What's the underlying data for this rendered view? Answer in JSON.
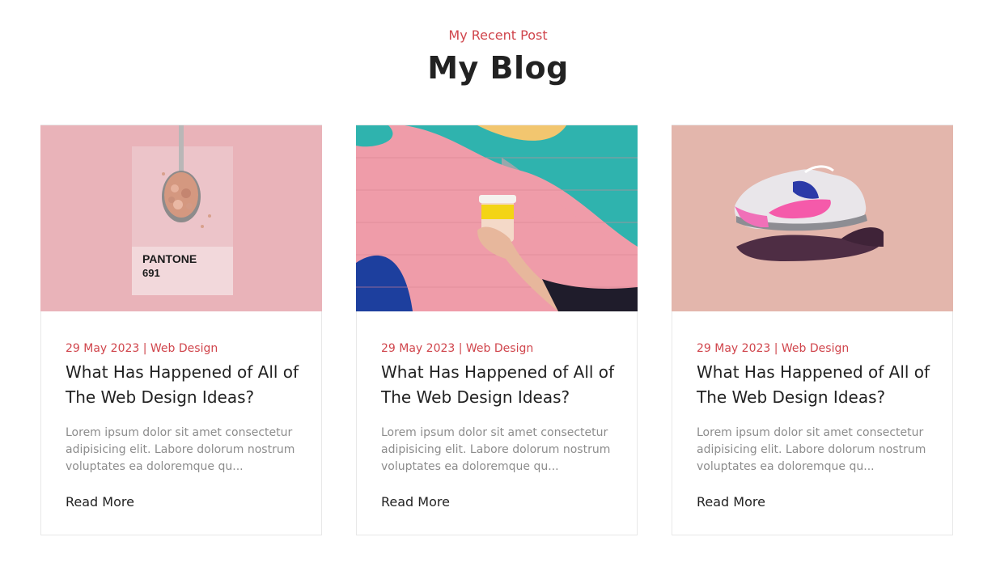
{
  "header": {
    "eyebrow": "My Recent Post",
    "title": "My Blog"
  },
  "posts": [
    {
      "meta": "29 May 2023 | Web Design",
      "title": "What Has Happened of All of The Web Design Ideas?",
      "excerpt": "Lorem ipsum dolor sit amet consectetur adipisicing elit. Labore dolorum nostrum voluptates ea doloremque qu...",
      "link": "Read More",
      "image": {
        "card_text": "PANTONE",
        "card_code": "691"
      }
    },
    {
      "meta": "29 May 2023 | Web Design",
      "title": "What Has Happened of All of The Web Design Ideas?",
      "excerpt": "Lorem ipsum dolor sit amet consectetur adipisicing elit. Labore dolorum nostrum voluptates ea doloremque qu...",
      "link": "Read More"
    },
    {
      "meta": "29 May 2023 | Web Design",
      "title": "What Has Happened of All of The Web Design Ideas?",
      "excerpt": "Lorem ipsum dolor sit amet consectetur adipisicing elit. Labore dolorum nostrum voluptates ea doloremque qu...",
      "link": "Read More"
    }
  ],
  "colors": {
    "accent": "#d0454c",
    "heading": "#222222",
    "body_text": "#8c8c8c",
    "border": "#e8e8e8"
  }
}
